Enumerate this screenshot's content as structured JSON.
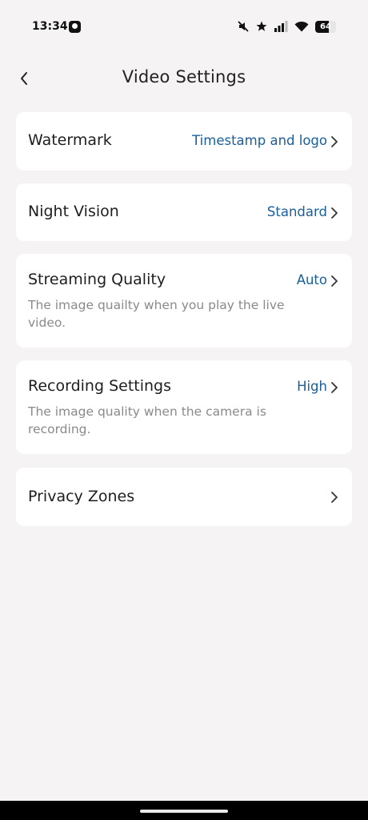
{
  "status_bar": {
    "time": "13:34",
    "battery_level": "64",
    "battery_fraction": 0.64
  },
  "header": {
    "title": "Video Settings",
    "back_icon": "chevron-left-icon"
  },
  "settings": [
    {
      "title": "Watermark",
      "value": "Timestamp and logo",
      "description": ""
    },
    {
      "title": "Night Vision",
      "value": "Standard",
      "description": ""
    },
    {
      "title": "Streaming Quality",
      "value": "Auto",
      "description": "The image quailty when you play the live video."
    },
    {
      "title": "Recording Settings",
      "value": "High",
      "description": "The image quality when the camera is recording."
    },
    {
      "title": "Privacy Zones",
      "value": "",
      "description": ""
    }
  ],
  "colors": {
    "background": "#f5f3f4",
    "card": "#ffffff",
    "accent": "#1a5f9a",
    "secondary_text": "#8a8a8a"
  }
}
